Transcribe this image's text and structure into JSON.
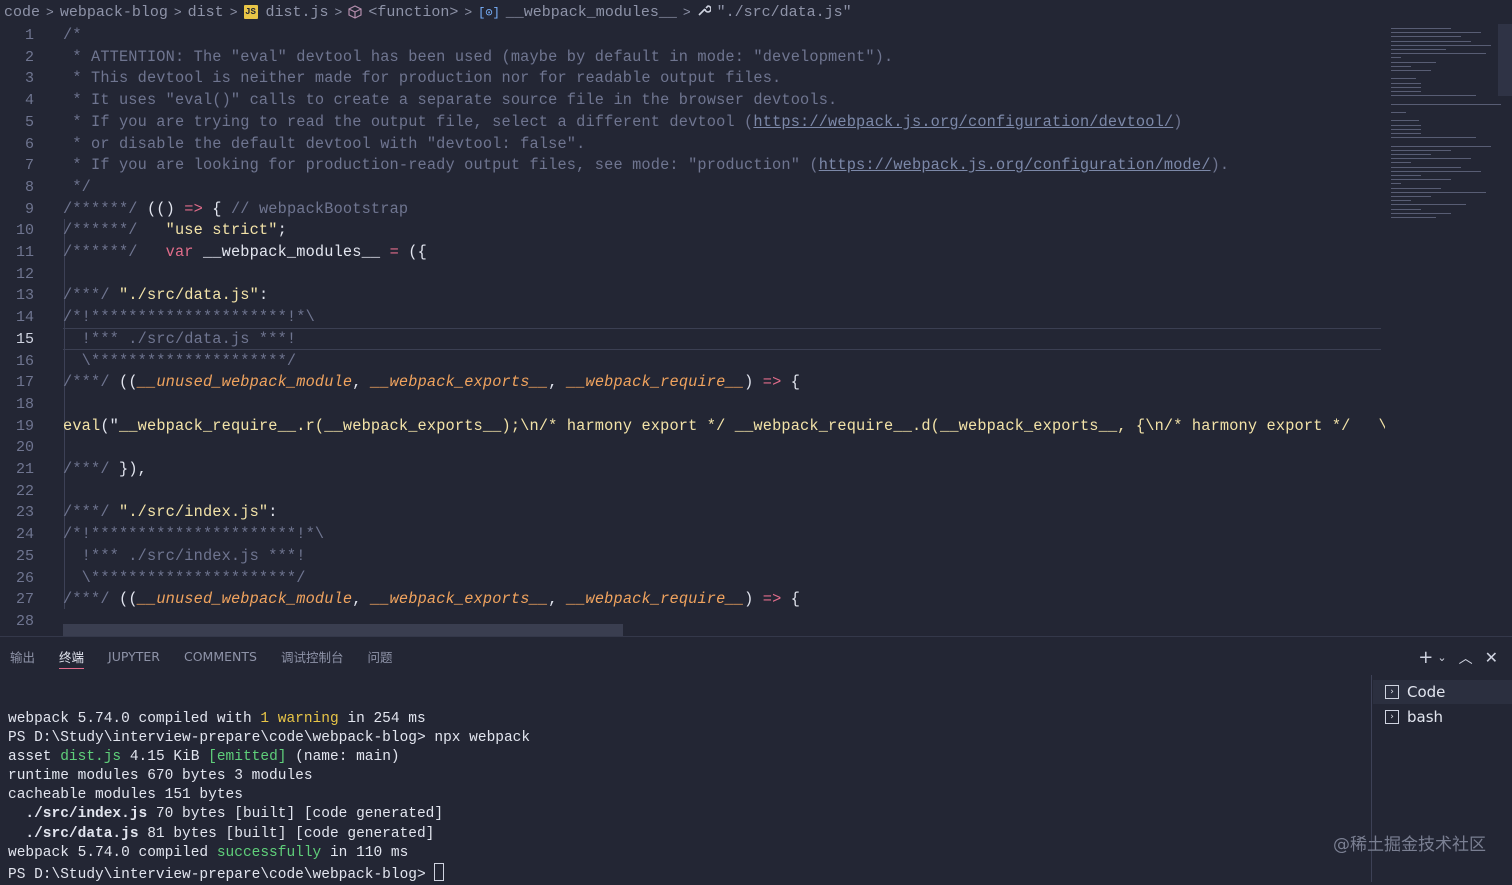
{
  "breadcrumb": {
    "items": [
      "code",
      "webpack-blog",
      "dist",
      "dist.js",
      "<function>",
      "__webpack_modules__",
      "\"./src/data.js\""
    ],
    "icons": [
      "",
      "",
      "",
      "js-file-icon",
      "cube-icon",
      "variable-icon",
      "wrench-icon"
    ]
  },
  "editor": {
    "active_line": 15,
    "lines": [
      {
        "n": "1",
        "t": [
          [
            "cmt",
            "/*"
          ]
        ]
      },
      {
        "n": "2",
        "t": [
          [
            "cmt",
            " * ATTENTION: The \"eval\" devtool has been used (maybe by default in mode: \"development\")."
          ]
        ]
      },
      {
        "n": "3",
        "t": [
          [
            "cmt",
            " * This devtool is neither made for production nor for readable output files."
          ]
        ]
      },
      {
        "n": "4",
        "t": [
          [
            "cmt",
            " * It uses \"eval()\" calls to create a separate source file in the browser devtools."
          ]
        ]
      },
      {
        "n": "5",
        "t": [
          [
            "cmt",
            " * If you are trying to read the output file, select a different devtool ("
          ],
          [
            "link",
            "https://webpack.js.org/configuration/devtool/"
          ],
          [
            "cmt",
            ")"
          ]
        ]
      },
      {
        "n": "6",
        "t": [
          [
            "cmt",
            " * or disable the default devtool with \"devtool: false\"."
          ]
        ]
      },
      {
        "n": "7",
        "t": [
          [
            "cmt",
            " * If you are looking for production-ready output files, see mode: \"production\" ("
          ],
          [
            "link",
            "https://webpack.js.org/configuration/mode/"
          ],
          [
            "cmt",
            ")."
          ]
        ]
      },
      {
        "n": "8",
        "t": [
          [
            "cmt",
            " */"
          ]
        ]
      },
      {
        "n": "9",
        "t": [
          [
            "cmt",
            "/******/ "
          ],
          [
            "def",
            "(() "
          ],
          [
            "op",
            "=>"
          ],
          [
            "def",
            " { "
          ],
          [
            "cmt",
            "// webpackBootstrap"
          ]
        ]
      },
      {
        "n": "10",
        "t": [
          [
            "cmt",
            "/******/ "
          ],
          [
            "def",
            "  "
          ],
          [
            "str",
            "\"use strict\""
          ],
          [
            "def",
            ";"
          ]
        ]
      },
      {
        "n": "11",
        "t": [
          [
            "cmt",
            "/******/ "
          ],
          [
            "def",
            "  "
          ],
          [
            "kw",
            "var"
          ],
          [
            "def",
            " __webpack_modules__ "
          ],
          [
            "op",
            "="
          ],
          [
            "def",
            " ({"
          ]
        ]
      },
      {
        "n": "12",
        "t": [
          [
            "def",
            ""
          ]
        ]
      },
      {
        "n": "13",
        "t": [
          [
            "cmt",
            "/***/ "
          ],
          [
            "str",
            "\"./src/data.js\""
          ],
          [
            "def",
            ":"
          ]
        ]
      },
      {
        "n": "14",
        "t": [
          [
            "cmt",
            "/*!*********************!*\\"
          ]
        ]
      },
      {
        "n": "15",
        "t": [
          [
            "cmt",
            "  !*** ./src/data.js ***!"
          ]
        ]
      },
      {
        "n": "16",
        "t": [
          [
            "cmt",
            "  \\*********************/"
          ]
        ]
      },
      {
        "n": "17",
        "t": [
          [
            "cmt",
            "/***/ "
          ],
          [
            "def",
            "(("
          ],
          [
            "param",
            "__unused_webpack_module"
          ],
          [
            "def",
            ", "
          ],
          [
            "param",
            "__webpack_exports__"
          ],
          [
            "def",
            ", "
          ],
          [
            "param",
            "__webpack_require__"
          ],
          [
            "def",
            ") "
          ],
          [
            "op",
            "=>"
          ],
          [
            "def",
            " {"
          ]
        ]
      },
      {
        "n": "18",
        "t": [
          [
            "def",
            ""
          ]
        ]
      },
      {
        "n": "19",
        "t": [
          [
            "fn",
            "eval"
          ],
          [
            "def",
            "(\""
          ],
          [
            "str",
            "__webpack_require__.r(__webpack_exports__);\\n/* harmony export */ __webpack_require__.d(__webpack_exports__, {\\n/* harmony export */   \\\"getBlog"
          ]
        ]
      },
      {
        "n": "20",
        "t": [
          [
            "def",
            ""
          ]
        ]
      },
      {
        "n": "21",
        "t": [
          [
            "cmt",
            "/***/ "
          ],
          [
            "def",
            "}),"
          ]
        ]
      },
      {
        "n": "22",
        "t": [
          [
            "def",
            ""
          ]
        ]
      },
      {
        "n": "23",
        "t": [
          [
            "cmt",
            "/***/ "
          ],
          [
            "str",
            "\"./src/index.js\""
          ],
          [
            "def",
            ":"
          ]
        ]
      },
      {
        "n": "24",
        "t": [
          [
            "cmt",
            "/*!**********************!*\\"
          ]
        ]
      },
      {
        "n": "25",
        "t": [
          [
            "cmt",
            "  !*** ./src/index.js ***!"
          ]
        ]
      },
      {
        "n": "26",
        "t": [
          [
            "cmt",
            "  \\**********************/"
          ]
        ]
      },
      {
        "n": "27",
        "t": [
          [
            "cmt",
            "/***/ "
          ],
          [
            "def",
            "(("
          ],
          [
            "param",
            "__unused_webpack_module"
          ],
          [
            "def",
            ", "
          ],
          [
            "param",
            "__webpack_exports__"
          ],
          [
            "def",
            ", "
          ],
          [
            "param",
            "__webpack_require__"
          ],
          [
            "def",
            ") "
          ],
          [
            "op",
            "=>"
          ],
          [
            "def",
            " {"
          ]
        ]
      },
      {
        "n": "28",
        "t": [
          [
            "def",
            ""
          ]
        ]
      }
    ]
  },
  "panel": {
    "tabs": [
      {
        "label": "输出",
        "active": false
      },
      {
        "label": "终端",
        "active": true
      },
      {
        "label": "JUPYTER",
        "active": false
      },
      {
        "label": "COMMENTS",
        "active": false
      },
      {
        "label": "调试控制台",
        "active": false
      },
      {
        "label": "问题",
        "active": false
      }
    ],
    "actions": [
      "plus-icon",
      "chevron-down-icon",
      "chevron-up-icon",
      "close-icon"
    ],
    "terminal_lines": [
      [
        [
          "",
          "webpack 5.74.0 compiled with "
        ],
        [
          "t-yel",
          "1 warning"
        ],
        [
          "",
          " in 254 ms"
        ]
      ],
      [
        [
          "",
          "PS D:\\Study\\interview-prepare\\code\\webpack-blog> npx webpack"
        ]
      ],
      [
        [
          "",
          "asset "
        ],
        [
          "t-green",
          "dist.js"
        ],
        [
          "",
          " 4.15 KiB "
        ],
        [
          "t-green",
          "[emitted]"
        ],
        [
          "",
          " (name: main)"
        ]
      ],
      [
        [
          "",
          "runtime modules 670 bytes 3 modules"
        ]
      ],
      [
        [
          "",
          "cacheable modules 151 bytes"
        ]
      ],
      [
        [
          "t-bold",
          "  ./src/index.js"
        ],
        [
          "",
          " 70 bytes [built] [code generated]"
        ]
      ],
      [
        [
          "t-bold",
          "  ./src/data.js"
        ],
        [
          "",
          " 81 bytes [built] [code generated]"
        ]
      ],
      [
        [
          "",
          "webpack 5.74.0 compiled "
        ],
        [
          "t-green",
          "successfully"
        ],
        [
          "",
          " in 110 ms"
        ]
      ],
      [
        [
          "",
          "PS D:\\Study\\interview-prepare\\code\\webpack-blog> "
        ]
      ]
    ],
    "terminals": [
      {
        "label": "Code",
        "selected": true
      },
      {
        "label": "bash",
        "selected": false
      }
    ]
  },
  "watermark": "@稀土掘金技术社区"
}
